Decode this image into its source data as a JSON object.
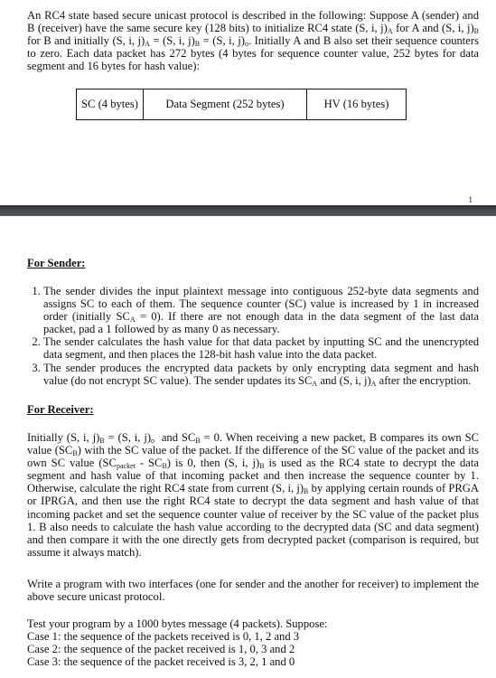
{
  "intro": {
    "text_html": "An RC4 state based secure unicast protocol is described in the following: Suppose A (sender) and B (receiver) have the same secure key (128 bits) to initialize RC4 state (S, i, j)<sub>A</sub> for A and (S, i, j)<sub>B</sub> for B and initially (S, i, j)<sub>A</sub> = (S, i, j)<sub>B</sub> = (S, i, j)<sub>o</sub>. Initially A and B also set their sequence counters to zero. Each data packet has 272 bytes (4 bytes for sequence counter value, 252 bytes for data segment and 16 bytes for hash value):"
  },
  "packet_format": {
    "cells": [
      "SC (4 bytes)",
      "Data Segment (252 bytes)",
      "HV (16 bytes)"
    ]
  },
  "page_number": "1",
  "sender": {
    "heading": "For Sender:",
    "steps_html": [
      "The sender divides the input plaintext message into contiguous 252-byte data segments and assigns SC to each of them. The sequence counter (SC) value is increased by 1 in increased order (initially SC<sub>A</sub> = 0). If there are not enough data in the data segment of the last data packet, pad a 1 followed by as many 0 as necessary.",
      "The sender calculates the hash value for that data packet by inputting SC and the unencrypted data segment, and then places the 128-bit hash value into the data packet.",
      "The sender produces the encrypted data packets by only encrypting data segment and hash value (do not encrypt SC value). The sender updates its SC<sub>A</sub> and (S, i, j)<sub>A</sub> after the encryption."
    ]
  },
  "receiver": {
    "heading": "For Receiver:",
    "text_html": "Initially (S, i, j)<sub>B</sub> = (S, i, j)<sub>o</sub> &nbsp;and SC<sub>B</sub> = 0. When receiving a new packet, B compares its own SC value (SC<sub>B</sub>) with the SC value of the packet. If the difference of the SC value of the packet and its own SC value (SC<sub>packet</sub> - SC<sub>B</sub>) is 0, then (S, i, j)<sub>B</sub> is used as the RC4 state to decrypt the data segment and hash value of that incoming packet and then increase the sequence counter by 1. Otherwise, calculate the right RC4 state from current (S, i, j)<sub>B</sub> by applying certain rounds of PRGA or IPRGA, and then use the right RC4 state to decrypt the data segment and hash value of that incoming packet and set the sequence counter value of receiver by the SC value of the packet plus 1. B also needs to calculate the hash value according to the decrypted data (SC and data segment) and then compare it with the one directly gets from decrypted packet (comparison is required, but assume it always match)."
  },
  "task": {
    "text": "Write a program with two interfaces (one for sender and the another for receiver) to implement the above secure unicast protocol."
  },
  "test": {
    "intro": "Test your program by a 1000 bytes message (4 packets). Suppose:",
    "cases": [
      "Case 1: the sequence of the packets received is 0, 1, 2 and 3",
      "Case 2: the sequence of the packet received is 1, 0, 3 and 2",
      "Case 3: the sequence of the packet received is 3, 2, 1 and 0"
    ]
  }
}
